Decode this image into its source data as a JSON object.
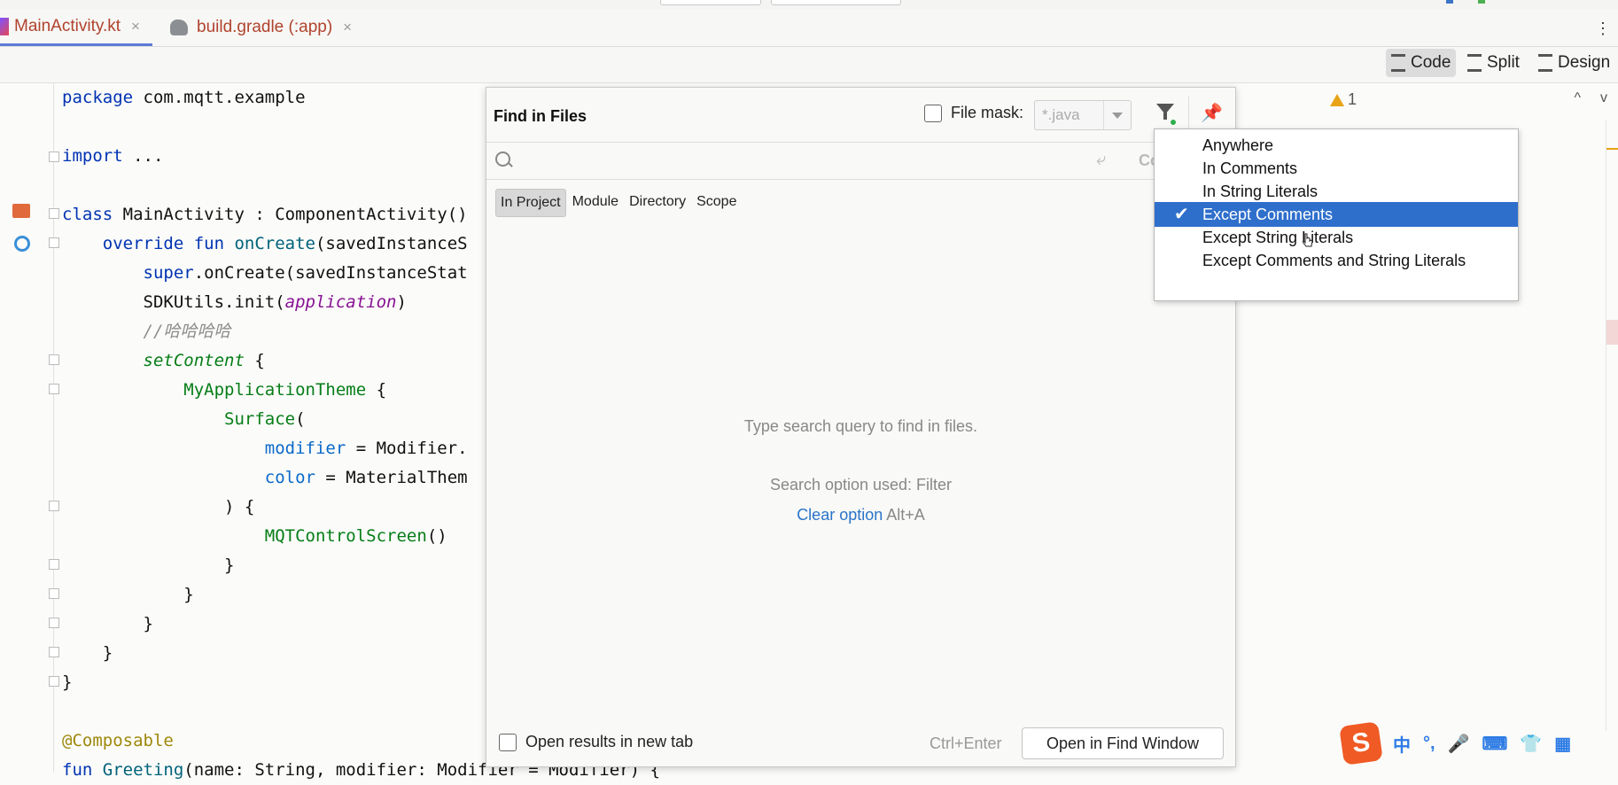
{
  "tabs": [
    {
      "label": "MainActivity.kt",
      "close": "×"
    },
    {
      "label": "build.gradle (:app)",
      "close": "×"
    }
  ],
  "more_icon": "⋮",
  "view_modes": {
    "code": "Code",
    "split": "Split",
    "design": "Design"
  },
  "warnings": {
    "count": "1",
    "up": "^",
    "down": "v"
  },
  "code_lines": [
    {
      "parts": [
        {
          "t": "package ",
          "c": "k"
        },
        {
          "t": "com.mqtt.example",
          "c": ""
        }
      ]
    },
    {
      "parts": []
    },
    {
      "parts": [
        {
          "t": "import ",
          "c": "k"
        },
        {
          "t": "...",
          "c": ""
        }
      ]
    },
    {
      "parts": []
    },
    {
      "parts": [
        {
          "t": "class ",
          "c": "k"
        },
        {
          "t": "MainActivity : ComponentActivity()",
          "c": ""
        }
      ]
    },
    {
      "parts": [
        {
          "t": "    override fun ",
          "c": "k"
        },
        {
          "t": "onCreate",
          "c": "fn"
        },
        {
          "t": "(savedInstanceS",
          "c": ""
        }
      ]
    },
    {
      "parts": [
        {
          "t": "        super",
          "c": "k"
        },
        {
          "t": ".onCreate(savedInstanceStat",
          "c": ""
        }
      ]
    },
    {
      "parts": [
        {
          "t": "        SDKUtils.init(",
          "c": ""
        },
        {
          "t": "application",
          "c": "it"
        },
        {
          "t": ")",
          "c": ""
        }
      ]
    },
    {
      "parts": [
        {
          "t": "        //哈哈哈哈",
          "c": "cm"
        }
      ]
    },
    {
      "parts": [
        {
          "t": "        ",
          "c": ""
        },
        {
          "t": "setContent",
          "c": "cc"
        },
        {
          "t": " {",
          "c": ""
        }
      ]
    },
    {
      "parts": [
        {
          "t": "            ",
          "c": ""
        },
        {
          "t": "MyApplicationTheme",
          "c": "gr"
        },
        {
          "t": " {",
          "c": ""
        }
      ]
    },
    {
      "parts": [
        {
          "t": "                ",
          "c": ""
        },
        {
          "t": "Surface",
          "c": "gr"
        },
        {
          "t": "(",
          "c": ""
        }
      ]
    },
    {
      "parts": [
        {
          "t": "                    ",
          "c": ""
        },
        {
          "t": "modifier",
          "c": "pm"
        },
        {
          "t": " = Modifier.",
          "c": ""
        }
      ]
    },
    {
      "parts": [
        {
          "t": "                    ",
          "c": ""
        },
        {
          "t": "color",
          "c": "pm"
        },
        {
          "t": " = MaterialThem",
          "c": ""
        }
      ]
    },
    {
      "parts": [
        {
          "t": "                ) {",
          "c": ""
        }
      ]
    },
    {
      "parts": [
        {
          "t": "                    ",
          "c": ""
        },
        {
          "t": "MQTControlScreen",
          "c": "gr"
        },
        {
          "t": "()",
          "c": ""
        }
      ]
    },
    {
      "parts": [
        {
          "t": "                }",
          "c": ""
        }
      ]
    },
    {
      "parts": [
        {
          "t": "            }",
          "c": ""
        }
      ]
    },
    {
      "parts": [
        {
          "t": "        }",
          "c": ""
        }
      ]
    },
    {
      "parts": [
        {
          "t": "    }",
          "c": ""
        }
      ]
    },
    {
      "parts": [
        {
          "t": "}",
          "c": ""
        }
      ]
    },
    {
      "parts": []
    },
    {
      "parts": [
        {
          "t": "@Composable",
          "c": "an"
        }
      ]
    },
    {
      "parts": [
        {
          "t": "fun ",
          "c": "k"
        },
        {
          "t": "Greeting",
          "c": "fn"
        },
        {
          "t": "(name: String, modifier: Modifier = Modifier) {",
          "c": ""
        }
      ]
    }
  ],
  "dialog": {
    "title": "Find in Files",
    "file_mask_label": "File mask:",
    "file_mask_value": "*.java",
    "search_placeholder": "",
    "replace_glyph": "⤶",
    "cc_glyph": "Cc",
    "scopes": [
      "In Project",
      "Module",
      "Directory",
      "Scope"
    ],
    "empty_hint": "Type search query to find in files.",
    "option_used": "Search option used: Filter",
    "clear_option": "Clear option",
    "clear_shortcut": "Alt+A",
    "open_new_tab": "Open results in new tab",
    "shortcut": "Ctrl+Enter",
    "open_button": "Open in Find Window"
  },
  "filter_menu": {
    "items": [
      "Anywhere",
      "In Comments",
      "In String Literals",
      "Except Comments",
      "Except String Literals",
      "Except Comments and String Literals"
    ],
    "selected_index": 3,
    "check": "✔"
  },
  "ime": {
    "logo": "S",
    "items": [
      "中",
      "°,",
      "🎤",
      "⌨",
      "👕",
      "▦"
    ]
  },
  "colors": {
    "accent": "#2f6fcc",
    "link": "#2a73c8",
    "warning": "#e8a317",
    "ime": "#f05a24"
  }
}
